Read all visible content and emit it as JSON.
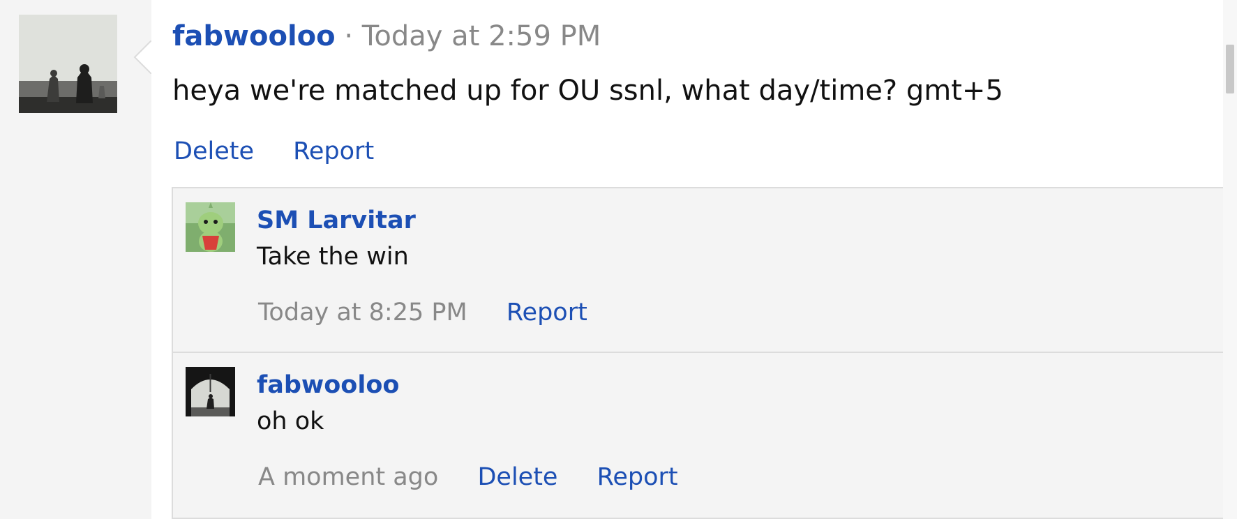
{
  "post": {
    "author": "fabwooloo",
    "separator": "·",
    "timestamp": "Today at 2:59 PM",
    "body": "heya we're matched up for OU ssnl, what day/time? gmt+5",
    "actions": {
      "delete": "Delete",
      "report": "Report"
    }
  },
  "replies": [
    {
      "author": "SM Larvitar",
      "text": "Take the win",
      "timestamp": "Today at 8:25 PM",
      "report": "Report"
    },
    {
      "author": "fabwooloo",
      "text": "oh ok",
      "timestamp": "A moment ago",
      "delete": "Delete",
      "report": "Report"
    }
  ],
  "colors": {
    "link": "#1c4fb4",
    "muted": "#888888",
    "background": "#f4f4f4",
    "card": "#ffffff"
  }
}
